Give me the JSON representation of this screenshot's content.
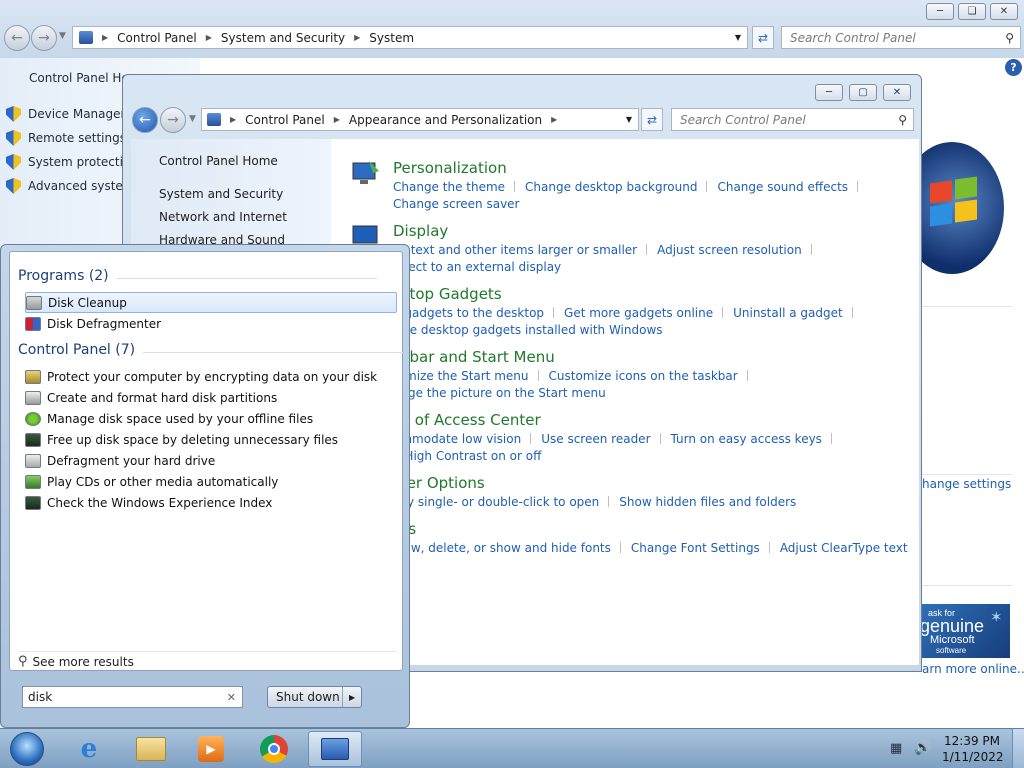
{
  "back_window": {
    "address": {
      "icon": "control-panel-icon",
      "crumbs": [
        "Control Panel",
        "System and Security",
        "System"
      ]
    },
    "search_placeholder": "Search Control Panel",
    "left_nav": {
      "home": "Control Panel Hom",
      "tasks": [
        {
          "label": "Device Manager",
          "icon": "shield-icon"
        },
        {
          "label": "Remote settings",
          "icon": "shield-icon"
        },
        {
          "label": "System protection",
          "icon": "shield-icon"
        },
        {
          "label": "Advanced system",
          "icon": "shield-icon"
        }
      ]
    },
    "change_settings_link": "hange settings",
    "genuine": {
      "line1": "ask for",
      "line2": "genuine",
      "line3": "Microsoft",
      "line4": "software",
      "learn_more": "arn more online..."
    }
  },
  "front_window": {
    "address": {
      "icon": "control-panel-icon",
      "crumbs": [
        "Control Panel",
        "Appearance and Personalization"
      ]
    },
    "search_placeholder": "Search Control Panel",
    "left_nav": [
      "Control Panel Home",
      "System and Security",
      "Network and Internet",
      "Hardware and Sound"
    ],
    "categories": [
      {
        "title": "Personalization",
        "rows": [
          [
            "Change the theme",
            "Change desktop background",
            "Change sound effects"
          ],
          [
            "Change screen saver"
          ]
        ]
      },
      {
        "title": "Display",
        "rows": [
          [
            "ke text and other items larger or smaller",
            "Adjust screen resolution"
          ],
          [
            "nnect to an external display"
          ]
        ]
      },
      {
        "title": "sktop Gadgets",
        "rows": [
          [
            "d gadgets to the desktop",
            "Get more gadgets online",
            "Uninstall a gadget"
          ],
          [
            "tore desktop gadgets installed with Windows"
          ]
        ]
      },
      {
        "title": "skbar and Start Menu",
        "rows": [
          [
            "tomize the Start menu",
            "Customize icons on the taskbar"
          ],
          [
            "ange the picture on the Start menu"
          ]
        ]
      },
      {
        "title": "se of Access Center",
        "rows": [
          [
            "ommodate low vision",
            "Use screen reader",
            "Turn on easy access keys"
          ],
          [
            "n High Contrast on or off"
          ]
        ]
      },
      {
        "title": "lder Options",
        "rows": [
          [
            "cify single- or double-click to open",
            "Show hidden files and folders"
          ]
        ]
      },
      {
        "title": "nts",
        "rows": [
          [
            "view, delete, or show and hide fonts",
            "Change Font Settings",
            "Adjust ClearType text"
          ]
        ]
      }
    ]
  },
  "start_menu": {
    "programs_header": "Programs (2)",
    "programs": [
      {
        "label": "Disk Cleanup",
        "icon": "disk-cleanup-icon",
        "selected": true
      },
      {
        "label": "Disk Defragmenter",
        "icon": "disk-defragmenter-icon",
        "selected": false
      }
    ],
    "control_panel_header": "Control Panel (7)",
    "control_panel": [
      {
        "label": "Protect your computer by encrypting data on your disk",
        "icon": "bitlocker-icon"
      },
      {
        "label": "Create and format hard disk partitions",
        "icon": "partition-icon"
      },
      {
        "label": "Manage disk space used by your offline files",
        "icon": "sync-icon"
      },
      {
        "label": "Free up disk space by deleting unnecessary files",
        "icon": "monitor-icon"
      },
      {
        "label": "Defragment your hard drive",
        "icon": "defrag-icon"
      },
      {
        "label": "Play CDs or other media automatically",
        "icon": "autoplay-icon"
      },
      {
        "label": "Check the Windows Experience Index",
        "icon": "monitor-icon"
      }
    ],
    "see_more": "See more results",
    "search_value": "disk",
    "shutdown_label": "Shut down"
  },
  "taskbar": {
    "apps": [
      "start-orb-icon",
      "internet-explorer-icon",
      "windows-explorer-icon",
      "media-player-icon",
      "chrome-icon",
      "control-panel-icon"
    ],
    "time": "12:39 PM",
    "date": "1/11/2022"
  },
  "colors": {
    "link": "#1e5fb3",
    "category_title": "#1f7a2a",
    "taskbar": "#8fb0cf"
  }
}
